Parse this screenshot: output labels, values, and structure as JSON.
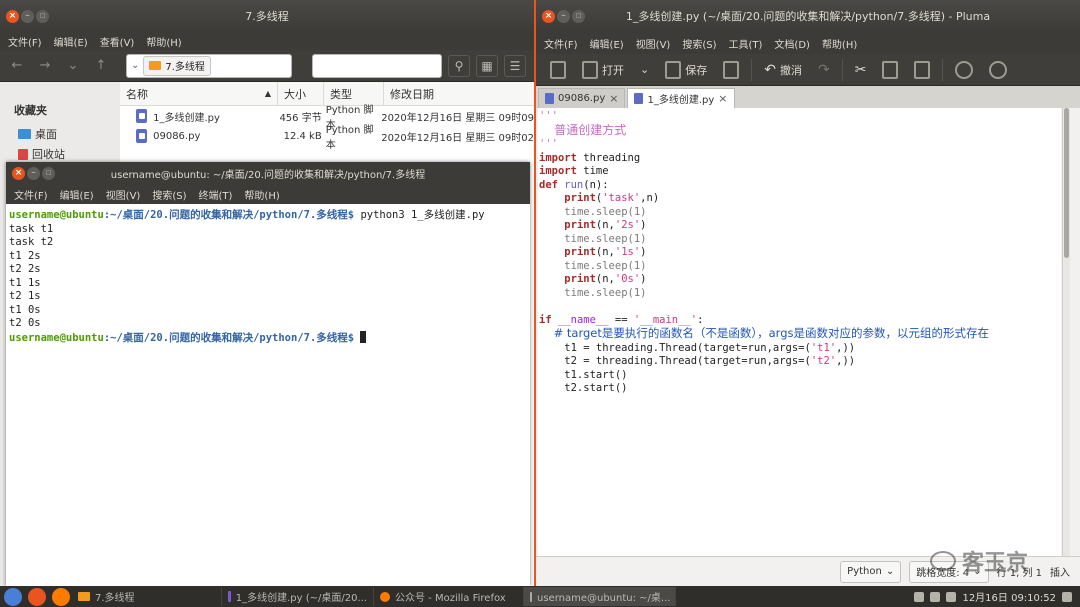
{
  "file_manager": {
    "title": "7.多线程",
    "menu": [
      "文件(F)",
      "编辑(E)",
      "查看(V)",
      "帮助(H)"
    ],
    "location": "7.多线程",
    "sidebar_heading": "收藏夹",
    "sidebar_items": [
      "桌面",
      "回收站"
    ],
    "columns": [
      "名称",
      "大小",
      "类型",
      "修改日期"
    ],
    "rows": [
      {
        "name": "1_多线创建.py",
        "size": "456 字节",
        "type": "Python 脚本",
        "date": "2020年12月16日 星期三 09时09"
      },
      {
        "name": "09086.py",
        "size": "12.4 kB",
        "type": "Python 脚本",
        "date": "2020年12月16日 星期三 09时02"
      }
    ]
  },
  "terminal": {
    "title": "username@ubuntu: ~/桌面/20.问题的收集和解决/python/7.多线程",
    "menu": [
      "文件(F)",
      "编辑(E)",
      "视图(V)",
      "搜索(S)",
      "终端(T)",
      "帮助(H)"
    ],
    "prompt_user": "username@ubuntu",
    "prompt_path": ":~/桌面/20.问题的收集和解决/python/7.多线程$",
    "command": " python3 1_多线创建.py",
    "output": [
      "task t1",
      "task t2",
      "t1 2s",
      "t2 2s",
      "t1 1s",
      "t2 1s",
      "t1 0s",
      "t2 0s"
    ]
  },
  "pluma": {
    "title": "1_多线创建.py (~/桌面/20.问题的收集和解决/python/7.多线程) - Pluma",
    "menu": [
      "文件(F)",
      "编辑(E)",
      "视图(V)",
      "搜索(S)",
      "工具(T)",
      "文档(D)",
      "帮助(H)"
    ],
    "toolbar": {
      "open": "打开",
      "save": "保存",
      "undo": "撤消"
    },
    "tabs": [
      "09086.py",
      "1_多线创建.py"
    ],
    "code": {
      "doc_open": "'''",
      "doc_text": "    普通创建方式",
      "doc_close": "'''",
      "import1_kw": "import",
      "import1_mod": " threading",
      "import2_kw": "import",
      "import2_mod": " time",
      "def_kw": "def",
      "def_name": " run",
      "def_args": "(n):",
      "print_kw": "print",
      "l1_args_a": "(",
      "l1_str": "'task'",
      "l1_args_b": ",n)",
      "sleep": "time.sleep(1)",
      "l2_a": "(n,",
      "l2_str": "'2s'",
      "l3_str": "'1s'",
      "l4_str": "'0s'",
      "close_paren": ")",
      "if_kw": "if",
      "main_name": " __name__",
      "main_eq": " == ",
      "main_str": "'__main__'",
      "main_colon": ":",
      "comment": "    # target是要执行的函数名（不是函数），args是函数对应的参数，以元组的形式存在",
      "t1_a": "    t1 = threading.Thread(target=run,args=(",
      "t1_str": "'t1'",
      "t1_b": ",))",
      "t2_a": "    t2 = threading.Thread(target=run,args=(",
      "t2_str": "'t2'",
      "t2_b": ",))",
      "start1": "    t1.start()",
      "start2": "    t2.start()"
    },
    "status": {
      "language": "Python",
      "tab_width": "跳格宽度: 4",
      "position": "行 1, 列 1",
      "mode": "插入"
    }
  },
  "taskbar": {
    "tasks": [
      "7.多线程",
      "1_多线创建.py (~/桌面/20...",
      "公众号 - Mozilla Firefox",
      "username@ubuntu: ~/桌..."
    ],
    "clock": "12月16日 09:10:52"
  },
  "watermark": "客玉京",
  "colors": {
    "accent": "#e95420",
    "titlebar": "#3c3b37",
    "prompt_user": "#4e9a06",
    "prompt_path": "#3465a4"
  }
}
